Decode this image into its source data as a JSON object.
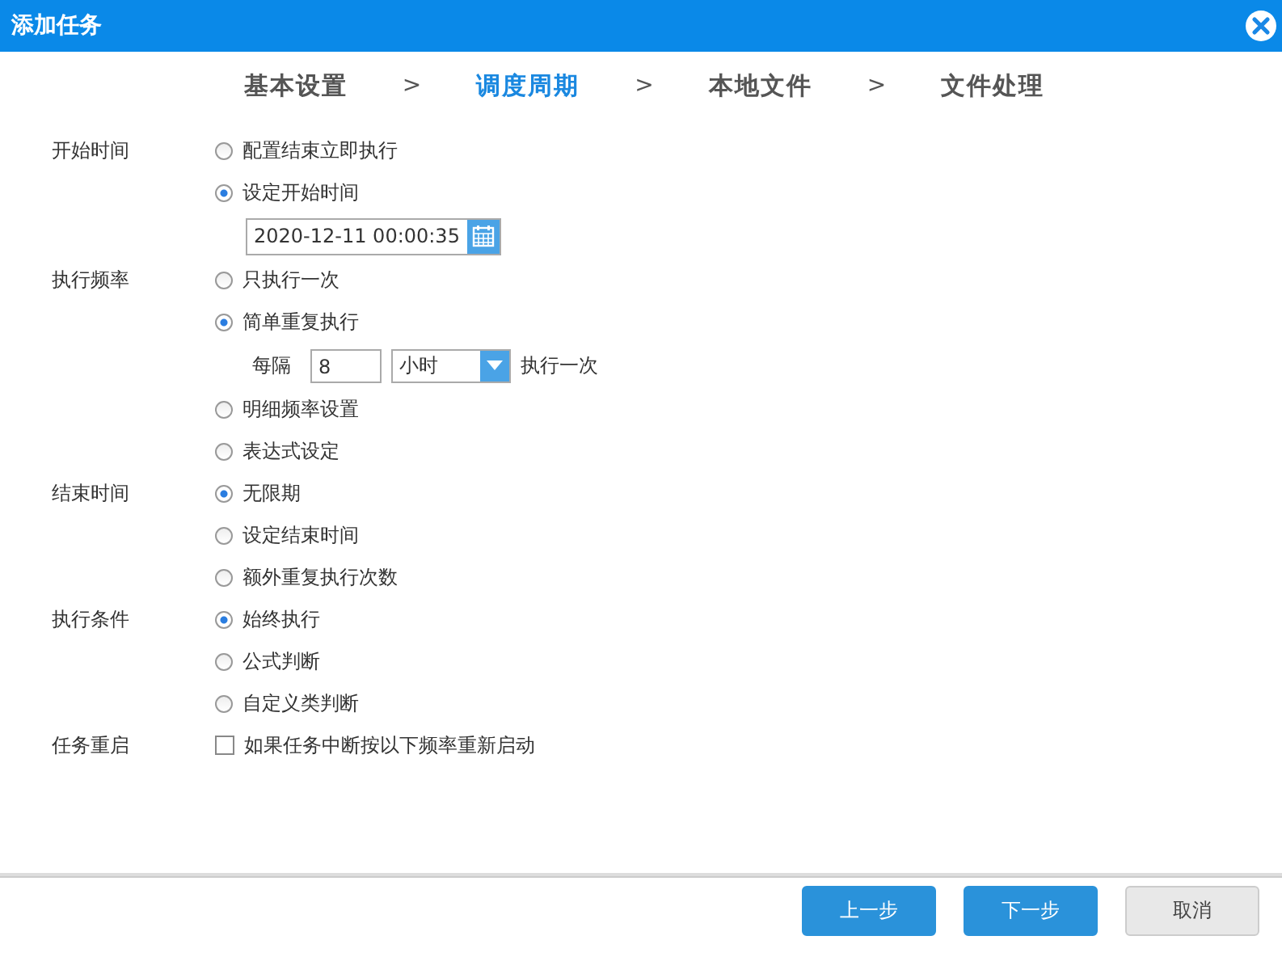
{
  "window": {
    "title": "添加任务"
  },
  "steps": [
    {
      "label": "基本设置",
      "selected": false
    },
    {
      "label": "调度周期",
      "selected": true
    },
    {
      "label": "本地文件",
      "selected": false
    },
    {
      "label": "文件处理",
      "selected": false
    }
  ],
  "step_separator": ">",
  "sections": [
    {
      "label": "开始时间",
      "items": [
        {
          "kind": "radio",
          "label": "配置结束立即执行",
          "selected": false
        },
        {
          "kind": "radio",
          "label": "设定开始时间",
          "selected": true
        },
        {
          "kind": "datetime",
          "value": "2020-12-11 00:00:35"
        }
      ]
    },
    {
      "label": "执行频率",
      "items": [
        {
          "kind": "radio",
          "label": "只执行一次",
          "selected": false
        },
        {
          "kind": "radio",
          "label": "简单重复执行",
          "selected": true
        },
        {
          "kind": "interval",
          "prefix": "每隔",
          "value": "8",
          "unit": "小时",
          "suffix": "执行一次"
        },
        {
          "kind": "radio",
          "label": "明细频率设置",
          "selected": false
        },
        {
          "kind": "radio",
          "label": "表达式设定",
          "selected": false
        }
      ]
    },
    {
      "label": "结束时间",
      "items": [
        {
          "kind": "radio",
          "label": "无限期",
          "selected": true
        },
        {
          "kind": "radio",
          "label": "设定结束时间",
          "selected": false
        },
        {
          "kind": "radio",
          "label": "额外重复执行次数",
          "selected": false
        }
      ]
    },
    {
      "label": "执行条件",
      "items": [
        {
          "kind": "radio",
          "label": "始终执行",
          "selected": true
        },
        {
          "kind": "radio",
          "label": "公式判断",
          "selected": false
        },
        {
          "kind": "radio",
          "label": "自定义类判断",
          "selected": false
        }
      ]
    },
    {
      "label": "任务重启",
      "items": [
        {
          "kind": "checkbox",
          "label": "如果任务中断按以下频率重新启动",
          "checked": false
        }
      ]
    }
  ],
  "buttons": [
    {
      "label": "上一步",
      "kind": "primary"
    },
    {
      "label": "下一步",
      "kind": "primary"
    },
    {
      "label": "取消",
      "kind": "secondary"
    }
  ]
}
